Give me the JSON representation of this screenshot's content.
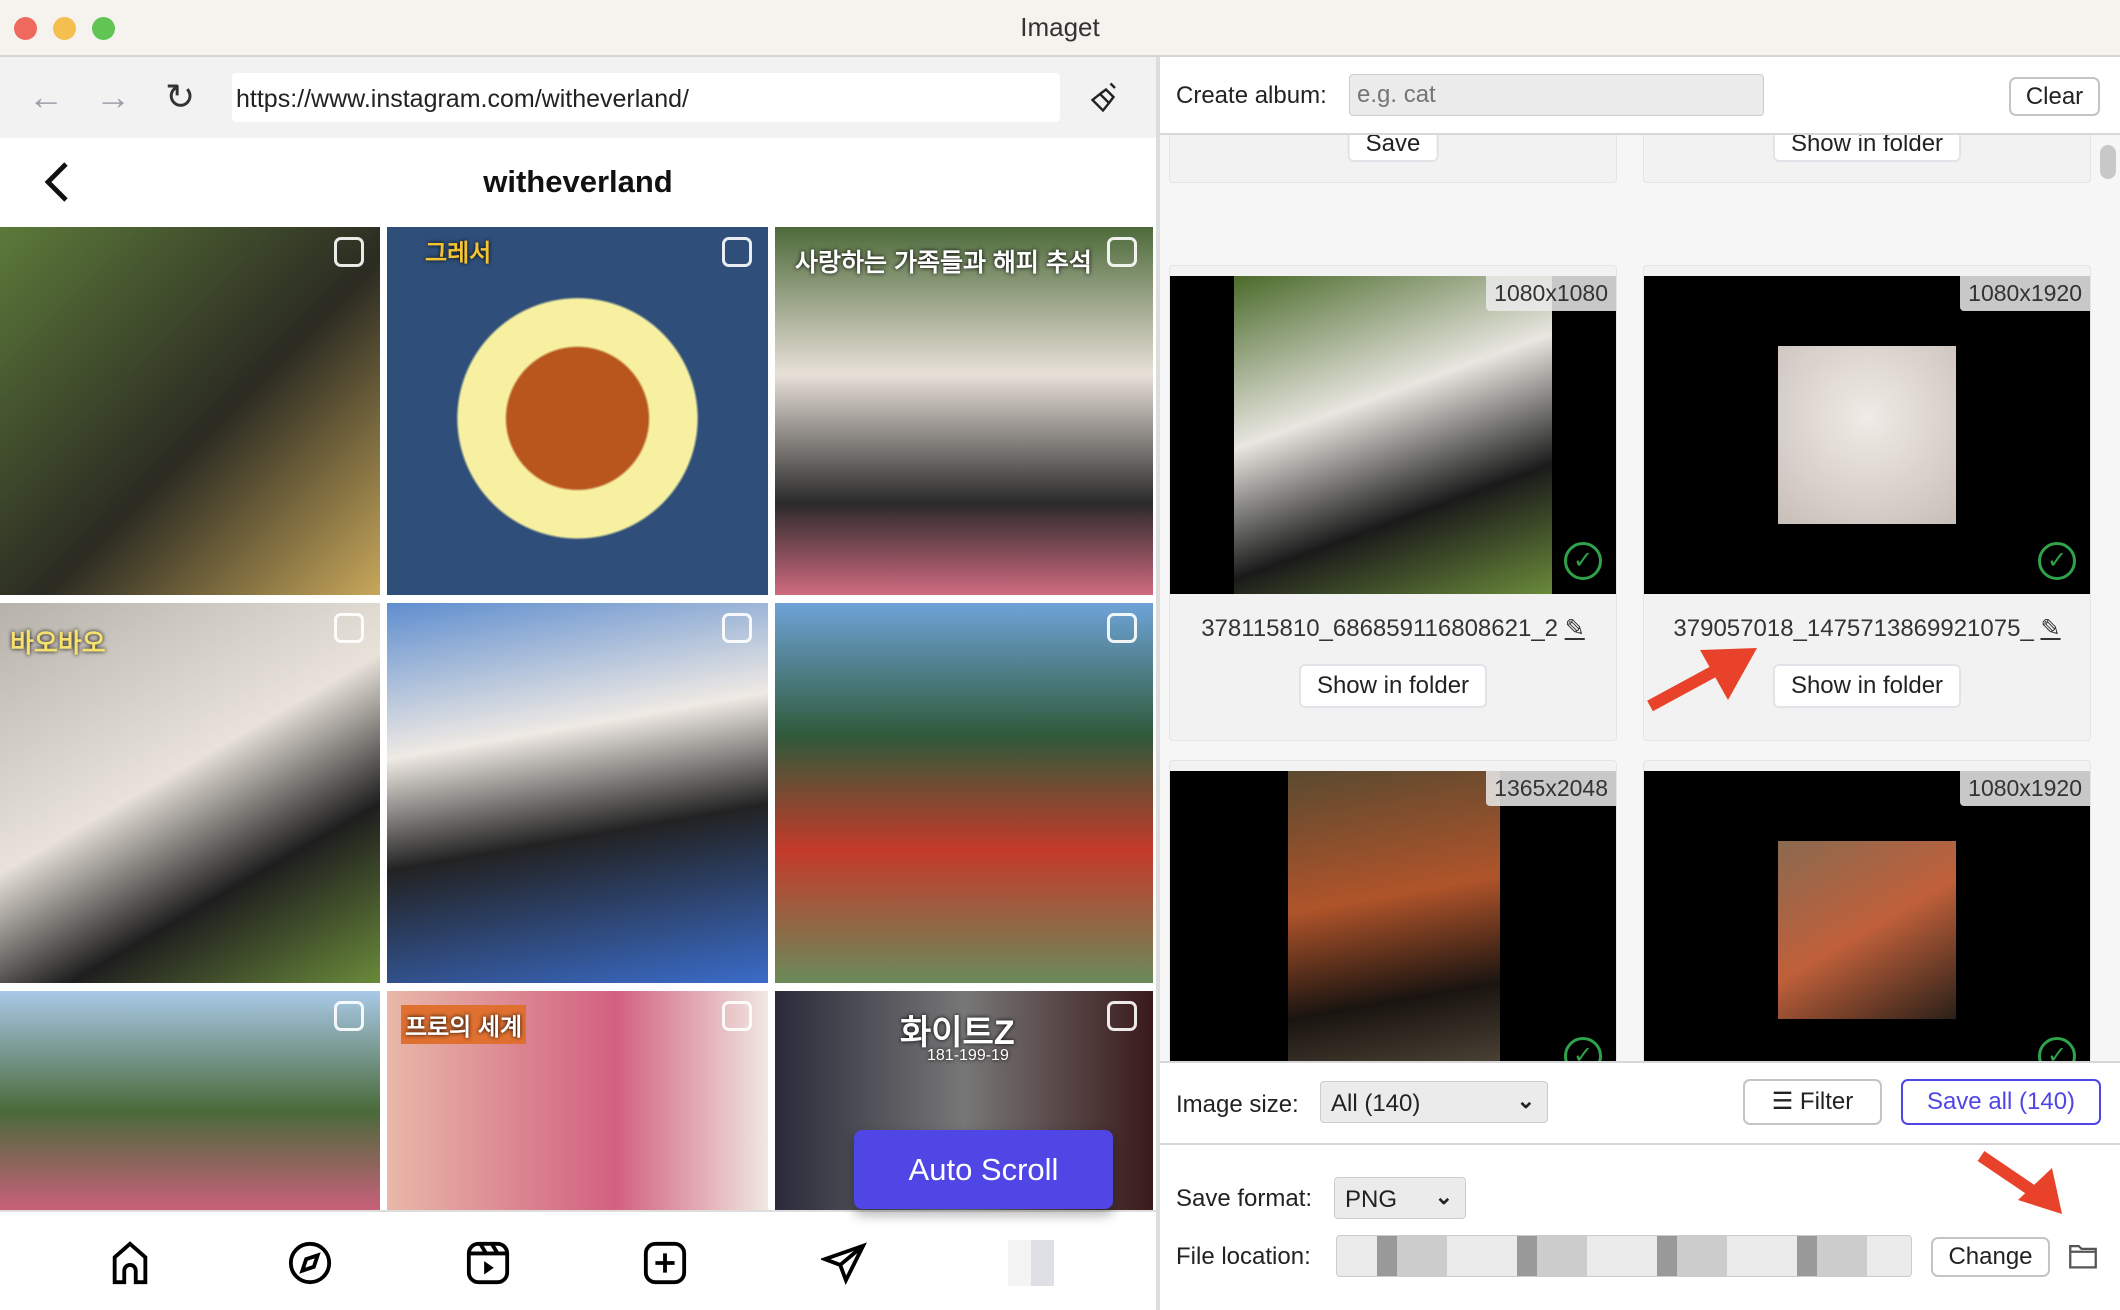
{
  "window": {
    "title": "Imaget"
  },
  "browser": {
    "url": "https://www.instagram.com/witheverland/",
    "back_icon": "←",
    "forward_icon": "→",
    "reload_icon": "↻"
  },
  "instagram": {
    "profile_title": "witheverland",
    "auto_scroll_label": "Auto Scroll",
    "captions": {
      "tile2": "그레서",
      "tile3": "사랑하는 가족들과 해피 추석",
      "tile4": "바오바오",
      "tile8": "프로의 세계",
      "tile9_title": "화이트Z",
      "tile9_sub": "181-199-19"
    },
    "nav_items": [
      "home",
      "explore",
      "reels",
      "create",
      "messages",
      "profile"
    ]
  },
  "album": {
    "label": "Create album:",
    "placeholder": "e.g. cat",
    "clear_label": "Clear"
  },
  "top_partial_cards": [
    {
      "button": "Save"
    },
    {
      "button": "Show in folder"
    }
  ],
  "cards": [
    {
      "dimensions": "1080x1080",
      "filename": "378115810_686859116808621_2",
      "button": "Show in folder",
      "colors": [
        "#3f5a2c",
        "#8aa35a"
      ]
    },
    {
      "dimensions": "1080x1920",
      "filename": "379057018_1475713869921075_",
      "button": "Show in folder",
      "colors": [
        "#d8d2ce",
        "#b5aaa5"
      ]
    },
    {
      "dimensions": "1365x2048",
      "filename": "",
      "button": "",
      "colors": [
        "#6b5a3a",
        "#b5512a"
      ]
    },
    {
      "dimensions": "1080x1920",
      "filename": "",
      "button": "",
      "colors": [
        "#8a6a50",
        "#c0603a"
      ]
    }
  ],
  "controls": {
    "image_size_label": "Image size:",
    "image_size_value": "All (140)",
    "filter_label": "Filter",
    "save_all_label": "Save all (140)",
    "save_format_label": "Save format:",
    "save_format_value": "PNG",
    "file_location_label": "File location:",
    "change_label": "Change"
  },
  "colors": {
    "accent": "#4f46e5",
    "check": "#2fa34a",
    "annotation": "#e8432a"
  }
}
